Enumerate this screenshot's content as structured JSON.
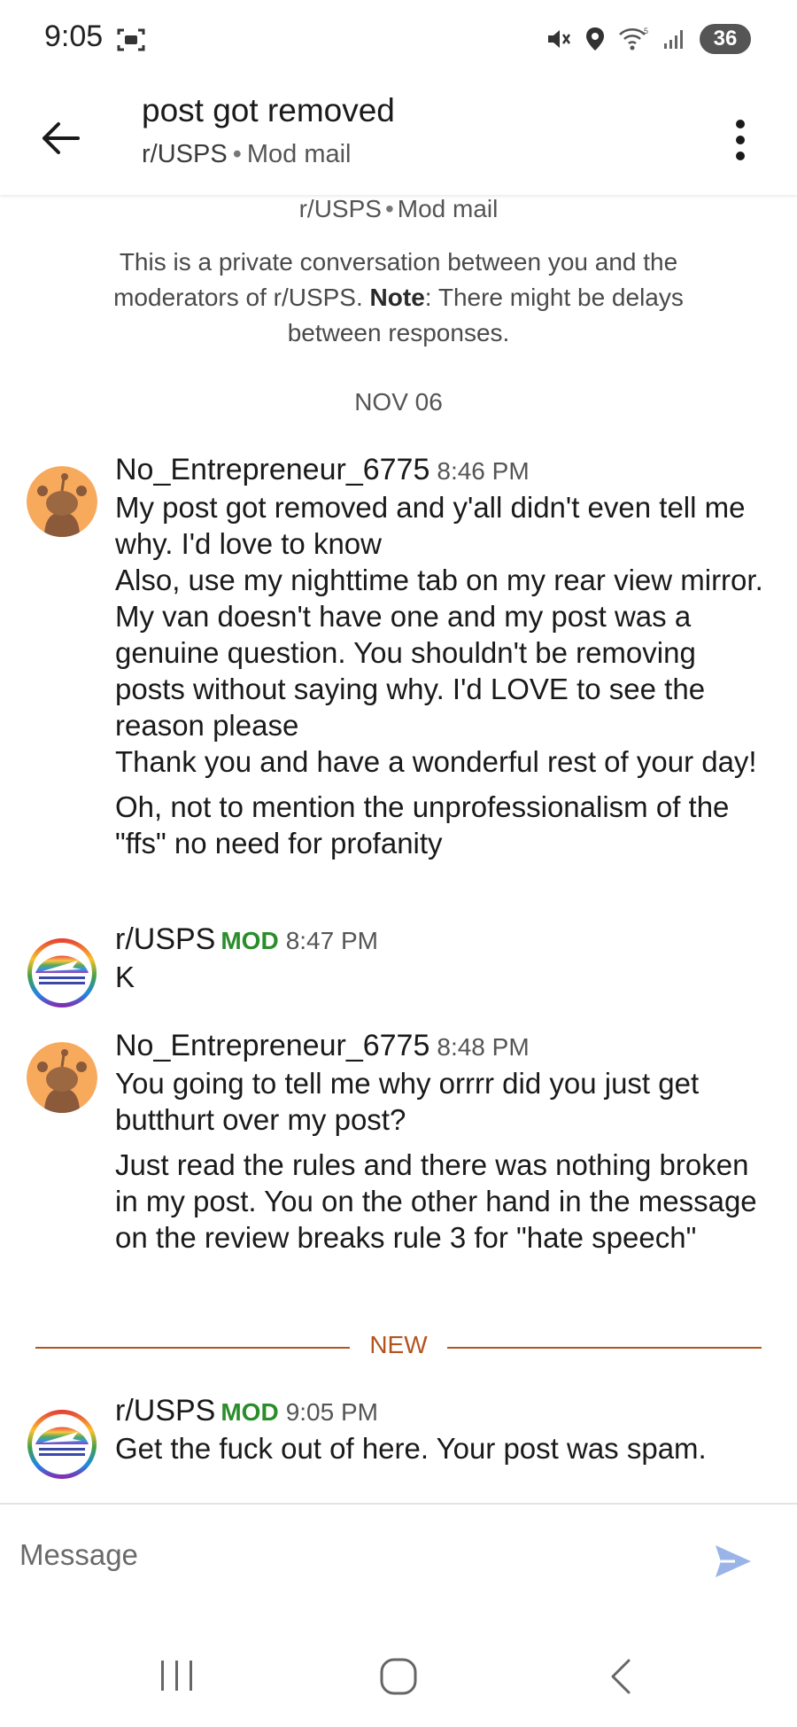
{
  "status_bar": {
    "time": "9:05",
    "battery": "36"
  },
  "header": {
    "title": "post got removed",
    "subreddit": "r/USPS",
    "separator": "•",
    "section": "Mod mail"
  },
  "intro": {
    "subreddit": "r/USPS",
    "separator": "•",
    "section": "Mod mail",
    "text_before": "This is a private conversation between you and the moderators of r/USPS. ",
    "note_label": "Note",
    "text_after": ": There might be delays between responses."
  },
  "date_separator": "NOV 06",
  "messages": [
    {
      "author": "No_Entrepreneur_6775",
      "time": "8:46 PM",
      "lines": [
        "My post got removed and y'all didn't even tell me why. I'd love to know",
        "Also, use my nighttime tab on my rear view mirror. My van doesn't have one and my post was a genuine question. You shouldn't be removing posts without saying why. I'd LOVE to see the reason please",
        "Thank you and have a wonderful rest of your day!",
        "Oh, not to mention the unprofessionalism of the \"ffs\" no need for profanity"
      ]
    },
    {
      "author": "r/USPS",
      "mod_tag": "MOD",
      "time": "8:47 PM",
      "lines": [
        "K"
      ]
    },
    {
      "author": "No_Entrepreneur_6775",
      "time": "8:48 PM",
      "lines": [
        "You going to tell me why orrrr did you just get butthurt over my post?",
        "Just read the rules and there was nothing broken in my post. You on the other hand in the message on the review breaks rule 3 for \"hate speech\""
      ]
    },
    {
      "author": "r/USPS",
      "mod_tag": "MOD",
      "time": "9:05 PM",
      "lines": [
        "Get the fuck out of here. Your post was spam."
      ]
    }
  ],
  "new_separator": "NEW",
  "composer": {
    "placeholder": "Message"
  },
  "colors": {
    "mod_green": "#2a8d2a",
    "new_orange": "#b5531f",
    "send_blue": "#9ab4e8",
    "snoo_bg": "#f7a95c"
  },
  "icons": {
    "back": "arrow-left-icon",
    "more": "more-vertical-icon",
    "send": "send-icon",
    "snoo_avatar": "snoo-avatar-icon",
    "usps_avatar": "usps-logo-icon"
  }
}
